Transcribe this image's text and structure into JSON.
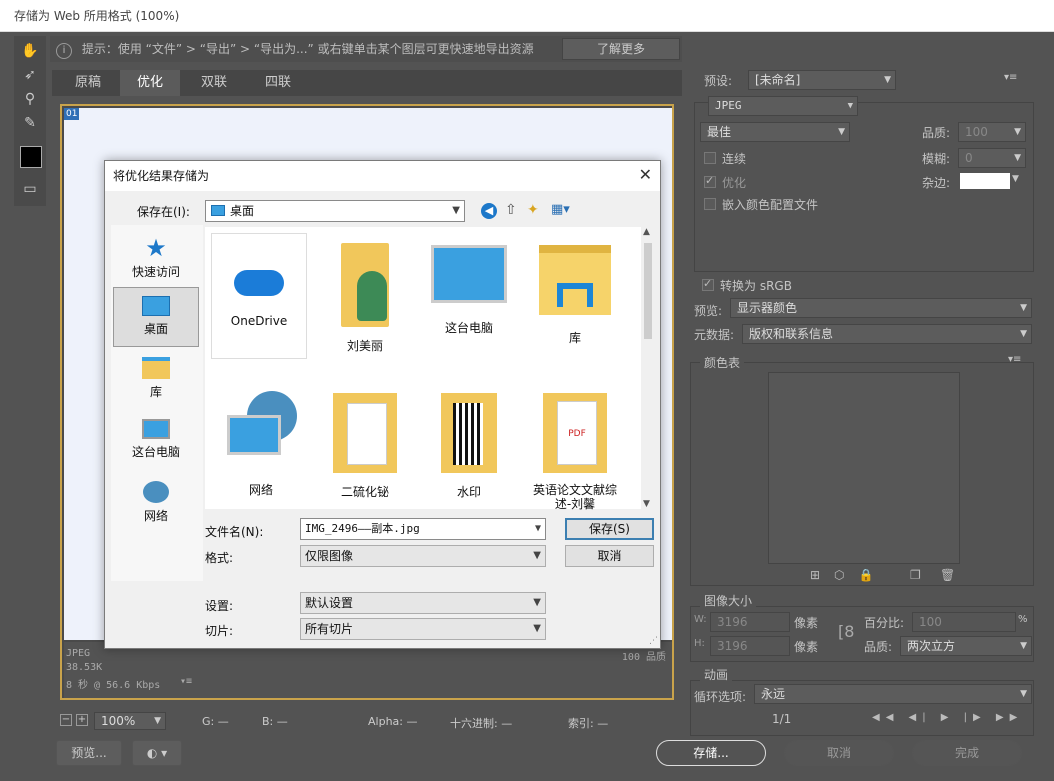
{
  "window": {
    "title": "存储为 Web 所用格式 (100%)"
  },
  "info": {
    "text": "提示：使用 “文件” > “导出” > “导出为...” 或右键单击某个图层可更快速地导出资源",
    "learn_more": "了解更多"
  },
  "tabs": [
    "原稿",
    "优化",
    "双联",
    "四联"
  ],
  "canvas": {
    "badge": "01",
    "info_line1": "JPEG",
    "info_line2": "38.53K",
    "info_line3": "8 秒 @ 56.6 Kbps",
    "quality_text": "100 品质"
  },
  "bottombar": {
    "zoom": "100%",
    "g": "G: —",
    "b": "B: —",
    "alpha": "Alpha: —",
    "hex": "十六进制: —",
    "index": "索引: —"
  },
  "footer": {
    "preview": "预览...",
    "save": "存储...",
    "cancel": "取消",
    "done": "完成"
  },
  "right": {
    "preset_label": "预设:",
    "preset_value": "[未命名]",
    "format": "JPEG",
    "quality_preset": "最佳",
    "quality_label": "品质:",
    "quality_value": "100",
    "progressive": "连续",
    "blur_label": "模糊:",
    "blur_value": "0",
    "optimized": "优化",
    "matte_label": "杂边:",
    "embed_profile": "嵌入颜色配置文件",
    "convert_srgb": "转换为 sRGB",
    "preview_label": "预览:",
    "preview_value": "显示器颜色",
    "metadata_label": "元数据:",
    "metadata_value": "版权和联系信息",
    "color_table": "颜色表",
    "image_size": "图像大小",
    "w_label": "W:",
    "w_value": "3196",
    "h_label": "H:",
    "h_value": "3196",
    "px": "像素",
    "percent_label": "百分比:",
    "percent_value": "100",
    "percent_unit": "%",
    "quality2_label": "品质:",
    "quality2_value": "两次立方",
    "animation": "动画",
    "loop_label": "循环选项:",
    "loop_value": "永远",
    "frame": "1/1"
  },
  "dialog": {
    "title": "将优化结果存储为",
    "save_in_label": "保存在(I):",
    "save_in_value": "桌面",
    "places": [
      "快速访问",
      "桌面",
      "库",
      "这台电脑",
      "网络"
    ],
    "files": [
      "OneDrive",
      "刘美丽",
      "这台电脑",
      "库",
      "网络",
      "二硫化铋",
      "水印",
      "英语论文文献综述-刘馨"
    ],
    "filename_label": "文件名(N):",
    "filename_value": "IMG_2496——副本.jpg",
    "format_label": "格式:",
    "format_value": "仅限图像",
    "settings_label": "设置:",
    "settings_value": "默认设置",
    "slices_label": "切片:",
    "slices_value": "所有切片",
    "save_btn": "保存(S)",
    "cancel_btn": "取消"
  },
  "colors": {
    "accent": "#c9a34b",
    "win_blue": "#3c7fb1",
    "folder": "#f1c75b",
    "screen": "#3aa0e0"
  }
}
